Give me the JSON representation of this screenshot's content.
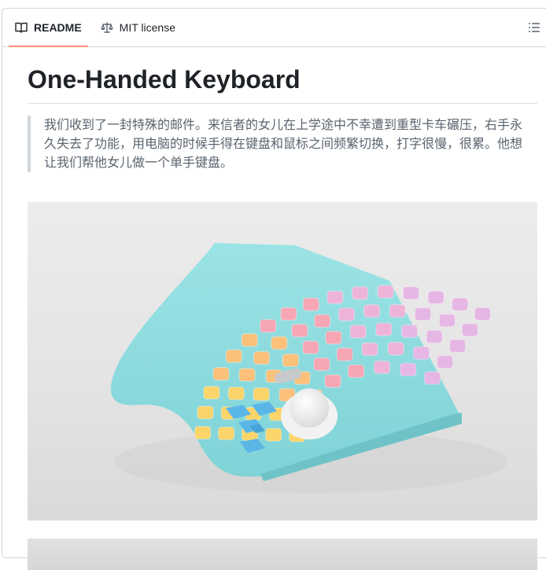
{
  "tabs": [
    {
      "label": "README",
      "icon": "book-icon",
      "active": true
    },
    {
      "label": "MIT license",
      "icon": "law-icon",
      "active": false
    }
  ],
  "toolbar": {
    "menu_icon": "list-unordered-icon"
  },
  "readme": {
    "title": "One-Handed Keyboard",
    "quote": "我们收到了一封特殊的邮件。来信者的女儿在上学途中不幸遭到重型卡车碾压，右手永久失去了功能，用电脑的时候手得在键盘和鼠标之间频繁切换，打字很慢，很累。他想让我们帮他女儿做一个单手键盘。"
  },
  "images": [
    {
      "icon": "keyboard-photo"
    },
    {
      "icon": "second-photo"
    }
  ],
  "colors": {
    "accent_underline": "#fd8c73",
    "keyboard_case": "#8fdde0",
    "keycaps": [
      "#fbd46a",
      "#fbc07a",
      "#f7a6b4",
      "#eeb4d8",
      "#e6b6e4"
    ]
  }
}
